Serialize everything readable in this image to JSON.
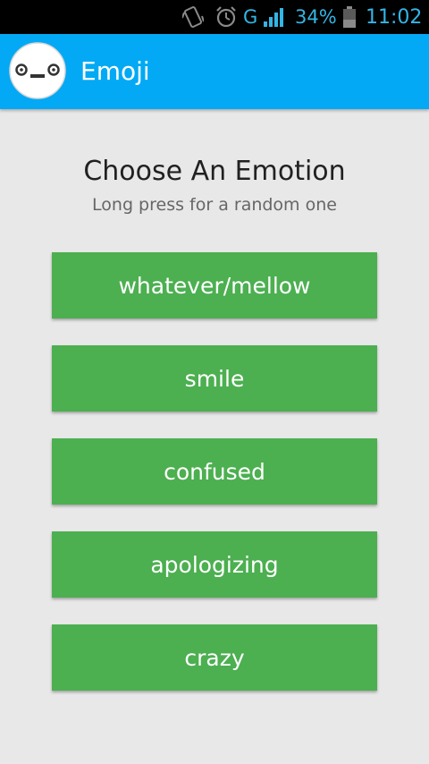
{
  "status_bar": {
    "battery_percent": "34%",
    "network": "G",
    "time": "11:02",
    "icons": [
      "vibrate-icon",
      "alarm-icon",
      "signal-icon",
      "battery-icon"
    ],
    "color": "#33b5e5"
  },
  "action_bar": {
    "title": "Emoji",
    "icon": "emoji-face-icon",
    "background": "#03a9f4"
  },
  "main": {
    "heading": "Choose An Emotion",
    "subheading": "Long press for a random one",
    "buttons": [
      {
        "label": "whatever/mellow"
      },
      {
        "label": "smile"
      },
      {
        "label": "confused"
      },
      {
        "label": "apologizing"
      },
      {
        "label": "crazy"
      }
    ],
    "button_color": "#4caf50"
  }
}
